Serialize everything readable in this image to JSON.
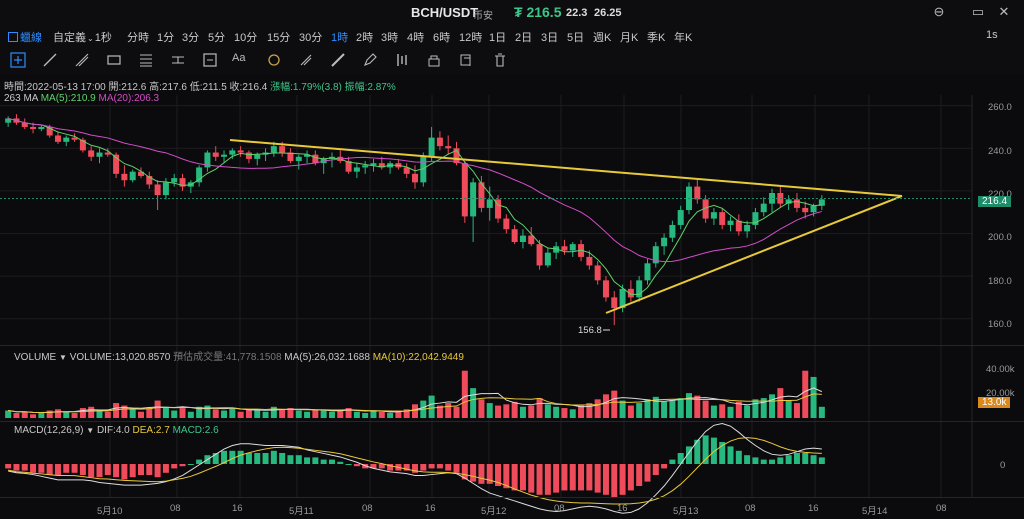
{
  "header": {
    "pair": "BCH/USDT",
    "pair_sub": "币安",
    "price": "₮ 216.5",
    "change": "22.3",
    "change_pct": "26.25",
    "win_buttons": [
      "⊖",
      "▭",
      "✕"
    ]
  },
  "timeframes": {
    "items": [
      "分時",
      "1分",
      "3分",
      "5分",
      "10分",
      "15分",
      "30分",
      "1時",
      "2時",
      "3時",
      "4時",
      "6時",
      "12時",
      "1日",
      "2日",
      "3日",
      "5日",
      "週K",
      "月K",
      "季K",
      "年K"
    ],
    "active": "1時",
    "chart_mode": "蠟線",
    "custom": "自定義",
    "custom_sub": "1秒",
    "right": "1s"
  },
  "tools": [
    "cursor-tool",
    "line-tool",
    "ray-tool",
    "parallel-tool",
    "rect-tool",
    "fib-tool",
    "measure-tool",
    "price-range-tool",
    "alert-tool",
    "text-tool",
    "brush-tool",
    "magnet-tool",
    "ruler-tool",
    "pencil-tool",
    "compare-tool",
    "lock-tool",
    "hide-tool",
    "copy-tool",
    "layers-tool",
    "delete-tool"
  ],
  "ohlc_bar": {
    "time": "時間:2022-05-13 17:00",
    "open": "開:212.6",
    "high": "高:217.6",
    "low": "低:211.5",
    "close": "收:216.4",
    "change": "漲幅:1.79%(3.8)",
    "amplitude": "振幅:2.87%"
  },
  "ma_bar": {
    "label": "263 MA",
    "ma5": "MA(5):210.9",
    "ma20": "MA(20):206.3"
  },
  "price_axis": [
    "260.0",
    "240.0",
    "220.0",
    "200.0",
    "180.0",
    "160.0"
  ],
  "current_price_tag": "216.4",
  "low_marker": "156.8",
  "volume_bar": {
    "label": "VOLUME",
    "volume": "VOLUME:13,020.8570",
    "estimate": "預估成交量:41,778.1508",
    "ma5": "MA(5):26,032.1688",
    "ma10": "MA(10):22,042.9449"
  },
  "volume_axis": [
    "40.00k",
    "20.00k"
  ],
  "volume_tag": "13.0k",
  "macd_bar": {
    "label": "MACD(12,26,9)",
    "dif": "DIF:4.0",
    "dea": "DEA:2.7",
    "macd": "MACD:2.6"
  },
  "macd_axis": "0",
  "time_axis": [
    "5月10",
    "08",
    "16",
    "5月11",
    "08",
    "16",
    "5月12",
    "08",
    "16",
    "5月13",
    "08",
    "16",
    "5月14",
    "08"
  ],
  "colors": {
    "up": "#26b87e",
    "down": "#ef4b5a",
    "ma5": "#5fd36a",
    "ma20": "#d44cc9",
    "trend": "#e8c93a",
    "accent": "#2d8cff"
  },
  "candles": [
    [
      252,
      255,
      250,
      254
    ],
    [
      254,
      256,
      251,
      252
    ],
    [
      252,
      254,
      249,
      250
    ],
    [
      250,
      252,
      247,
      249
    ],
    [
      249,
      251,
      248,
      250
    ],
    [
      250,
      251,
      245,
      246
    ],
    [
      246,
      248,
      242,
      243
    ],
    [
      243,
      246,
      241,
      245
    ],
    [
      245,
      247,
      243,
      244
    ],
    [
      244,
      245,
      238,
      239
    ],
    [
      239,
      241,
      234,
      236
    ],
    [
      236,
      240,
      233,
      238
    ],
    [
      238,
      240,
      236,
      237
    ],
    [
      237,
      238,
      226,
      228
    ],
    [
      228,
      232,
      222,
      225
    ],
    [
      225,
      230,
      224,
      229
    ],
    [
      229,
      231,
      226,
      227
    ],
    [
      227,
      229,
      221,
      223
    ],
    [
      223,
      225,
      211,
      218
    ],
    [
      218,
      226,
      216,
      224
    ],
    [
      224,
      228,
      222,
      226
    ],
    [
      226,
      228,
      220,
      222
    ],
    [
      222,
      225,
      219,
      224
    ],
    [
      224,
      232,
      222,
      231
    ],
    [
      231,
      239,
      229,
      238
    ],
    [
      238,
      241,
      234,
      236
    ],
    [
      236,
      239,
      233,
      237
    ],
    [
      237,
      240,
      235,
      239
    ],
    [
      239,
      241,
      236,
      238
    ],
    [
      238,
      239,
      233,
      235
    ],
    [
      235,
      238,
      232,
      237
    ],
    [
      237,
      240,
      234,
      238
    ],
    [
      238,
      243,
      236,
      241
    ],
    [
      241,
      243,
      236,
      238
    ],
    [
      238,
      240,
      233,
      234
    ],
    [
      234,
      237,
      230,
      236
    ],
    [
      236,
      239,
      233,
      237
    ],
    [
      237,
      239,
      232,
      233
    ],
    [
      233,
      236,
      228,
      235
    ],
    [
      235,
      238,
      231,
      236
    ],
    [
      236,
      239,
      233,
      234
    ],
    [
      234,
      236,
      228,
      229
    ],
    [
      229,
      233,
      226,
      231
    ],
    [
      231,
      234,
      228,
      232
    ],
    [
      232,
      235,
      229,
      233
    ],
    [
      233,
      236,
      230,
      231
    ],
    [
      231,
      234,
      228,
      233
    ],
    [
      233,
      235,
      230,
      231
    ],
    [
      231,
      233,
      226,
      228
    ],
    [
      228,
      232,
      221,
      224
    ],
    [
      224,
      238,
      222,
      236
    ],
    [
      236,
      250,
      234,
      245
    ],
    [
      245,
      248,
      239,
      241
    ],
    [
      241,
      246,
      237,
      240
    ],
    [
      240,
      243,
      232,
      233
    ],
    [
      233,
      234,
      205,
      208
    ],
    [
      208,
      226,
      196,
      224
    ],
    [
      224,
      227,
      210,
      212
    ],
    [
      212,
      222,
      206,
      216
    ],
    [
      216,
      218,
      205,
      207
    ],
    [
      207,
      209,
      200,
      202
    ],
    [
      202,
      204,
      195,
      196
    ],
    [
      196,
      202,
      193,
      199
    ],
    [
      199,
      203,
      194,
      195
    ],
    [
      195,
      197,
      183,
      185
    ],
    [
      185,
      193,
      184,
      191
    ],
    [
      191,
      196,
      188,
      194
    ],
    [
      194,
      197,
      190,
      192
    ],
    [
      192,
      196,
      189,
      195
    ],
    [
      195,
      197,
      187,
      189
    ],
    [
      189,
      192,
      183,
      185
    ],
    [
      185,
      187,
      176,
      178
    ],
    [
      178,
      180,
      168,
      170
    ],
    [
      170,
      173,
      157,
      165
    ],
    [
      165,
      176,
      163,
      174
    ],
    [
      174,
      178,
      168,
      170
    ],
    [
      170,
      180,
      168,
      178
    ],
    [
      178,
      188,
      176,
      186
    ],
    [
      186,
      196,
      184,
      194
    ],
    [
      194,
      200,
      190,
      198
    ],
    [
      198,
      206,
      196,
      204
    ],
    [
      204,
      213,
      202,
      211
    ],
    [
      211,
      224,
      209,
      222
    ],
    [
      222,
      226,
      214,
      216
    ],
    [
      216,
      218,
      205,
      207
    ],
    [
      207,
      212,
      204,
      210
    ],
    [
      210,
      212,
      202,
      204
    ],
    [
      204,
      208,
      201,
      206
    ],
    [
      206,
      209,
      199,
      201
    ],
    [
      201,
      206,
      198,
      204
    ],
    [
      204,
      212,
      202,
      210
    ],
    [
      210,
      217,
      208,
      214
    ],
    [
      214,
      221,
      210,
      219
    ],
    [
      219,
      222,
      212,
      214
    ],
    [
      214,
      218,
      211,
      216
    ],
    [
      216,
      219,
      210,
      212
    ],
    [
      212,
      215,
      207,
      210
    ],
    [
      210,
      214,
      208,
      213
    ],
    [
      213,
      218,
      211,
      216
    ]
  ],
  "volumes": [
    6,
    4,
    5,
    3,
    4,
    6,
    7,
    5,
    4,
    8,
    9,
    6,
    5,
    12,
    10,
    7,
    5,
    8,
    14,
    9,
    6,
    8,
    5,
    9,
    10,
    7,
    6,
    8,
    5,
    7,
    6,
    5,
    9,
    7,
    8,
    6,
    5,
    7,
    6,
    5,
    6,
    8,
    5,
    4,
    6,
    5,
    4,
    6,
    7,
    11,
    14,
    18,
    10,
    12,
    9,
    38,
    24,
    15,
    12,
    10,
    11,
    13,
    9,
    10,
    16,
    11,
    9,
    8,
    7,
    10,
    12,
    15,
    19,
    22,
    14,
    10,
    12,
    15,
    17,
    13,
    14,
    16,
    20,
    18,
    14,
    10,
    11,
    9,
    13,
    10,
    15,
    16,
    19,
    24,
    14,
    12,
    38,
    33,
    9
  ],
  "macd_hist": [
    -2,
    -3,
    -3,
    -4,
    -4,
    -5,
    -5,
    -4,
    -4,
    -5,
    -6,
    -6,
    -5,
    -6,
    -7,
    -6,
    -5,
    -5,
    -6,
    -4,
    -2,
    -1,
    0,
    2,
    4,
    5,
    6,
    6,
    6,
    5,
    5,
    5,
    6,
    5,
    4,
    4,
    3,
    3,
    2,
    2,
    1,
    0,
    -1,
    -2,
    -2,
    -2,
    -3,
    -3,
    -3,
    -4,
    -3,
    -2,
    -2,
    -3,
    -4,
    -7,
    -8,
    -9,
    -9,
    -10,
    -11,
    -12,
    -12,
    -13,
    -14,
    -14,
    -13,
    -12,
    -12,
    -12,
    -12,
    -13,
    -14,
    -15,
    -14,
    -12,
    -10,
    -8,
    -5,
    -2,
    2,
    5,
    8,
    11,
    13,
    12,
    10,
    8,
    6,
    4,
    3,
    2,
    2,
    3,
    4,
    5,
    5,
    4,
    3
  ]
}
